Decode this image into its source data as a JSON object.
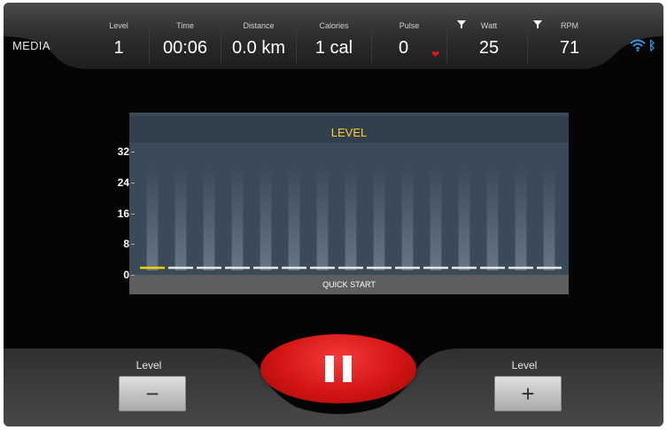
{
  "header": {
    "media_label": "MEDIA",
    "stats": [
      {
        "label": "Level",
        "value": "1"
      },
      {
        "label": "Time",
        "value": "00:06"
      },
      {
        "label": "Distance",
        "value": "0.0 km"
      },
      {
        "label": "Calories",
        "value": "1 cal"
      },
      {
        "label": "Pulse",
        "value": "0"
      },
      {
        "label": "Watt",
        "value": "25"
      },
      {
        "label": "RPM",
        "value": "71"
      }
    ],
    "icons": [
      "heart-icon",
      "filter-icon",
      "wifi-icon",
      "bluetooth-icon"
    ],
    "wifi_color": "#2f9de0"
  },
  "chart": {
    "title": "LEVEL",
    "y_ticks": [
      "32",
      "24",
      "16",
      "8",
      "0"
    ],
    "footer_label": "QUICK START",
    "colors": {
      "title": "#ffcc33",
      "active_segment": "#f5d000",
      "segment": "#e6e6e6",
      "panel": "#3b4a58"
    }
  },
  "chart_data": {
    "type": "bar",
    "title": "LEVEL",
    "ylim": [
      0,
      32
    ],
    "y_ticks": [
      0,
      8,
      16,
      24,
      32
    ],
    "segments": 15,
    "active_segment": 0,
    "values": [
      1,
      1,
      1,
      1,
      1,
      1,
      1,
      1,
      1,
      1,
      1,
      1,
      1,
      1,
      1
    ]
  },
  "controls": {
    "level_down_label": "Level",
    "level_down_symbol": "−",
    "level_up_label": "Level",
    "level_up_symbol": "+",
    "pause_color": "#d21414"
  }
}
